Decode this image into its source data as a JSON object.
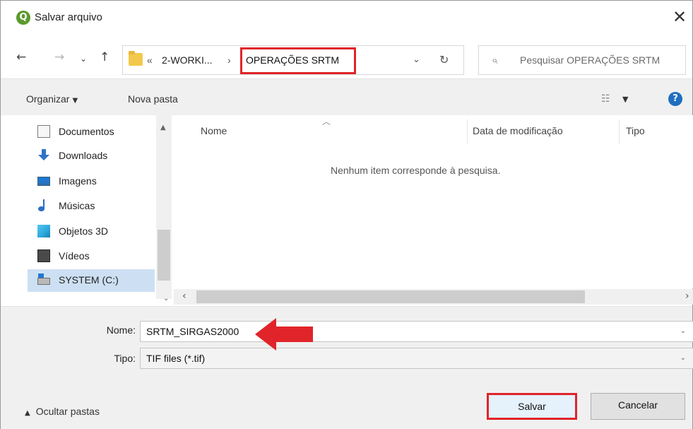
{
  "window": {
    "title": "Salvar arquivo",
    "close": "✕",
    "app_icon": "Q"
  },
  "nav": {
    "back": "←",
    "forward": "→",
    "recent": "⌄",
    "up": "↑"
  },
  "address": {
    "prefix": "«",
    "crumb1": "2-WORKI...",
    "separator": "›",
    "current": "OPERAÇÕES SRTM",
    "chevron": "⌄",
    "refresh": "↻"
  },
  "search": {
    "icon": "⌕",
    "placeholder": "Pesquisar OPERAÇÕES SRTM"
  },
  "toolbar": {
    "organize": "Organizar",
    "organize_caret": "▼",
    "new_folder": "Nova pasta",
    "view_icon": "☷",
    "view_caret": "▼",
    "help": "?"
  },
  "sidebar": {
    "items": [
      {
        "label": "Documentos",
        "icon": "document-icon"
      },
      {
        "label": "Downloads",
        "icon": "download-icon"
      },
      {
        "label": "Imagens",
        "icon": "images-icon"
      },
      {
        "label": "Músicas",
        "icon": "music-icon"
      },
      {
        "label": "Objetos 3D",
        "icon": "3d-objects-icon"
      },
      {
        "label": "Vídeos",
        "icon": "video-icon"
      },
      {
        "label": "SYSTEM (C:)",
        "icon": "drive-icon",
        "selected": true
      }
    ],
    "scroll_up": "▲",
    "scroll_down": "⌄"
  },
  "filelist": {
    "sort_indicator": "︿",
    "columns": [
      "Nome",
      "Data de modificação",
      "Tipo"
    ],
    "empty_message": "Nenhum item corresponde à pesquisa.",
    "scroll_left": "‹",
    "scroll_right": "›"
  },
  "form": {
    "name_label": "Nome:",
    "name_value": "SRTM_SIRGAS2000",
    "type_label": "Tipo:",
    "type_value": "TIF files (*.tif)",
    "caret": "⌄"
  },
  "footer": {
    "hide_folders_chevron": "▲",
    "hide_folders": "Ocultar pastas",
    "save": "Salvar",
    "cancel": "Cancelar"
  },
  "colors": {
    "highlight": "#e0242a",
    "selection": "#cde0f3",
    "accent": "#1f6fbf"
  }
}
